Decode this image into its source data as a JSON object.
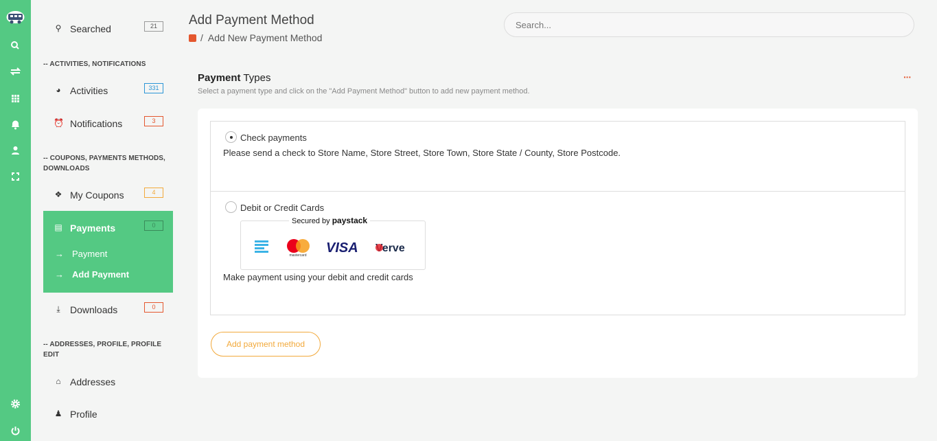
{
  "rail": {
    "icons": [
      "logo-icon",
      "search-icon",
      "exchange-icon",
      "grid-icon",
      "bell-icon",
      "user-icon",
      "expand-icon",
      "gear-icon",
      "power-icon"
    ]
  },
  "sidebar": {
    "searched": {
      "label": "Searched",
      "count": "21"
    },
    "section1": "-- ACTIVITIES, NOTIFICATIONS",
    "activities": {
      "label": "Activities",
      "count": "331"
    },
    "notifications": {
      "label": "Notifications",
      "count": "3"
    },
    "section2": "-- COUPONS, PAYMENTS METHODS, DOWNLOADS",
    "coupons": {
      "label": "My Coupons",
      "count": "4"
    },
    "payments": {
      "label": "Payments",
      "count": "0"
    },
    "payment_sub": "Payment",
    "add_payment_sub": "Add Payment",
    "downloads": {
      "label": "Downloads",
      "count": "0"
    },
    "section3": "-- ADDRESSES, PROFILE, PROFILE EDIT",
    "addresses": {
      "label": "Addresses"
    },
    "profile": {
      "label": "Profile"
    }
  },
  "header": {
    "title": "Add Payment Method",
    "breadcrumb_sep": "/",
    "breadcrumb_current": "Add New Payment Method",
    "search_placeholder": "Search..."
  },
  "section": {
    "title_bold": "Payment",
    "title_rest": " Types",
    "subtitle": "Select a payment type and click on the \"Add Payment Method\" button to add new payment method.",
    "more": "···"
  },
  "options": [
    {
      "label": "Check payments",
      "desc": "Please send a check to Store Name, Store Street, Store Town, Store State / County, Store Postcode.",
      "selected": true
    },
    {
      "label": "Debit or Credit Cards",
      "desc": "Make payment using your debit and credit cards",
      "selected": false
    }
  ],
  "paystack": {
    "secured_by": "Secured by",
    "brand": "paystack",
    "cards": [
      "mastercard",
      "VISA",
      "Verve"
    ]
  },
  "actions": {
    "add_button": "Add payment method"
  }
}
